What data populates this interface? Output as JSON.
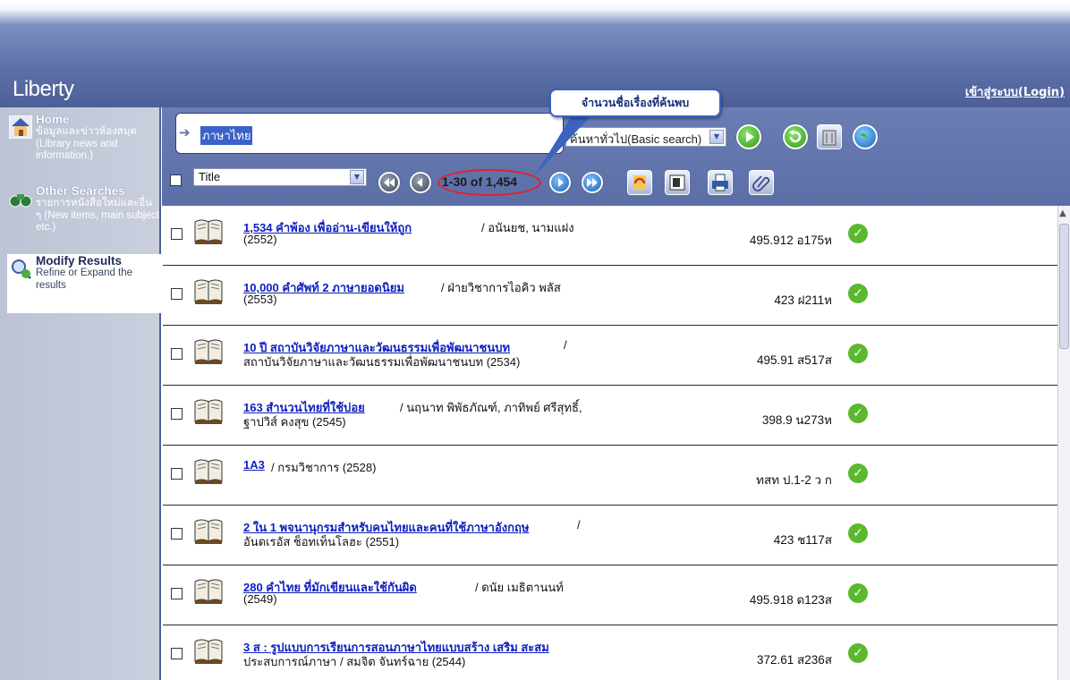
{
  "header": {
    "logo": "Liberty",
    "login": "เข้าสู่ระบบ(Login)"
  },
  "sidebar": {
    "items": [
      {
        "title": "Home",
        "desc": "ข้อมูลและข่าวห้องสมุด (Library news and information.)",
        "icon": "home-icon"
      },
      {
        "title": "Other Searches",
        "desc": "รายการหนังสือใหม่และอื่น ๆ (New items, main subject etc.)",
        "icon": "binoculars-icon"
      },
      {
        "title": "Modify Results",
        "desc": "Refine or Expand the results",
        "icon": "magnifier-icon"
      }
    ]
  },
  "search": {
    "value": "ภาษาไทย",
    "type": "ค้นหาทั่วไป(Basic search)",
    "field": "Title"
  },
  "pager": {
    "count": "1-30 of 1,454"
  },
  "callout": "จำนวนชื่อเรื่องที่ค้นพบ",
  "results": [
    {
      "title": "1,534 คำพ้อง เพื่ออ่าน-เขียนให้ถูก",
      "rest": "/ อนันยช, นามแฝง",
      "line2": "(2552)",
      "callno": "495.912 อ175ห"
    },
    {
      "title": "10,000 คำศัพท์ 2 ภาษายอดนิยม",
      "rest": "/ ฝ่ายวิชาการไอคิว พลัส",
      "line2": "(2553)",
      "callno": "423 ฝ211ห"
    },
    {
      "title": "10 ปี สถาบันวิจัยภาษาและวัฒนธรรมเพื่อพัฒนาชนบท",
      "rest": "/",
      "line2": "สถาบันวิจัยภาษาและวัฒนธรรมเพื่อพัฒนาชนบท (2534)",
      "callno": "495.91 ส517ส"
    },
    {
      "title": "163 สำนวนไทยที่ใช้บ่อย",
      "rest": "/ นฤนาท พิพัธภัณฑ์, ภาทิพย์ ศรีสุทธิ์,",
      "line2": "ฐาปวิส์ คงสุข (2545)",
      "callno": "398.9 น273ห"
    },
    {
      "title": "1A3",
      "rest": "/ กรมวิชาการ (2528)",
      "line2": "",
      "callno": "ทสท ป.1-2 ว ก"
    },
    {
      "title": "2 ใน 1 พจนานุกรมสำหรับคนไทยและคนที่ใช้ภาษาอังกฤษ",
      "rest": "/",
      "line2": "อันดเรอัส ช็อทเท็นโลฮะ (2551)",
      "callno": "423 ช117ส"
    },
    {
      "title": "280 คำไทย ที่มักเขียนและใช้กันผิด",
      "rest": "/ ดนัย เมธิตานนท์",
      "line2": "(2549)",
      "callno": "495.918 ด123ส"
    },
    {
      "title": "3 ส : รูปแบบการเรียนการสอนภาษาไทยแบบสร้าง เสริม สะสม",
      "rest": "",
      "line2": "ประสบการณ์ภาษา / สมจิต จันทร์ฉาย (2544)",
      "callno": "372.61 ส236ส"
    }
  ],
  "colors": {
    "header": "#5f74ac",
    "sidebar": "#bcc3d4",
    "link": "#1020c0",
    "highlight_oval": "#e2202e",
    "available": "#5cb82e"
  }
}
